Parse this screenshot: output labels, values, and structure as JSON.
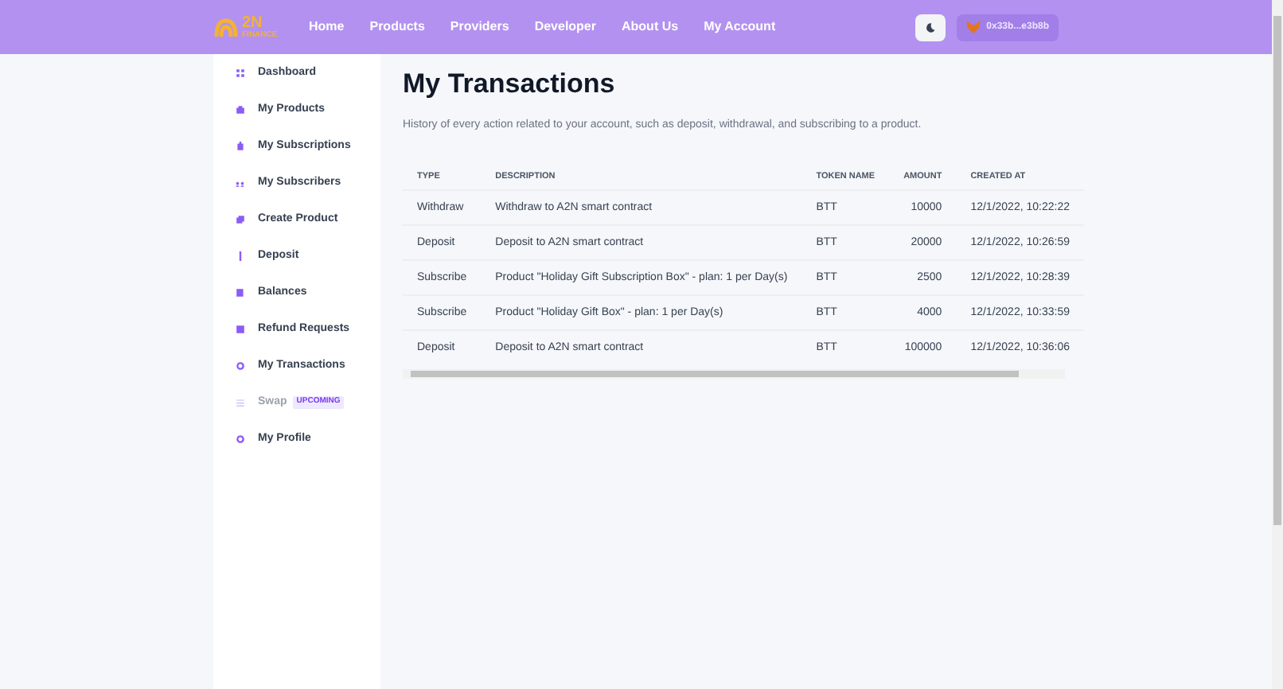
{
  "logo": {
    "mark": "2N",
    "sub": "FINANCE"
  },
  "nav": [
    "Home",
    "Products",
    "Providers",
    "Developer",
    "About Us",
    "My Account"
  ],
  "wallet": {
    "address": "0x33b...e3b8b"
  },
  "sidebar": {
    "items": [
      {
        "label": "Dashboard",
        "disabled": false
      },
      {
        "label": "My Products",
        "disabled": false
      },
      {
        "label": "My Subscriptions",
        "disabled": false
      },
      {
        "label": "My Subscribers",
        "disabled": false
      },
      {
        "label": "Create Product",
        "disabled": false
      },
      {
        "label": "Deposit",
        "disabled": false
      },
      {
        "label": "Balances",
        "disabled": false
      },
      {
        "label": "Refund Requests",
        "disabled": false
      },
      {
        "label": "My Transactions",
        "disabled": false
      },
      {
        "label": "Swap",
        "disabled": true,
        "badge": "UPCOMING"
      },
      {
        "label": "My Profile",
        "disabled": false
      }
    ]
  },
  "page": {
    "title": "My Transactions",
    "subtitle": "History of every action related to your account, such as deposit, withdrawal, and subscribing to a product."
  },
  "table": {
    "columns": [
      "TYPE",
      "DESCRIPTION",
      "TOKEN NAME",
      "AMOUNT",
      "CREATED AT"
    ],
    "rows": [
      [
        "Withdraw",
        "Withdraw to A2N smart contract",
        "BTT",
        "10000",
        "12/1/2022, 10:22:22"
      ],
      [
        "Deposit",
        "Deposit to A2N smart contract",
        "BTT",
        "20000",
        "12/1/2022, 10:26:59"
      ],
      [
        "Subscribe",
        "Product \"Holiday Gift Subscription Box\" - plan: 1 per Day(s)",
        "BTT",
        "2500",
        "12/1/2022, 10:28:39"
      ],
      [
        "Subscribe",
        "Product \"Holiday Gift Box\" - plan: 1 per Day(s)",
        "BTT",
        "4000",
        "12/1/2022, 10:33:59"
      ],
      [
        "Deposit",
        "Deposit to A2N smart contract",
        "BTT",
        "100000",
        "12/1/2022, 10:36:06"
      ]
    ]
  }
}
